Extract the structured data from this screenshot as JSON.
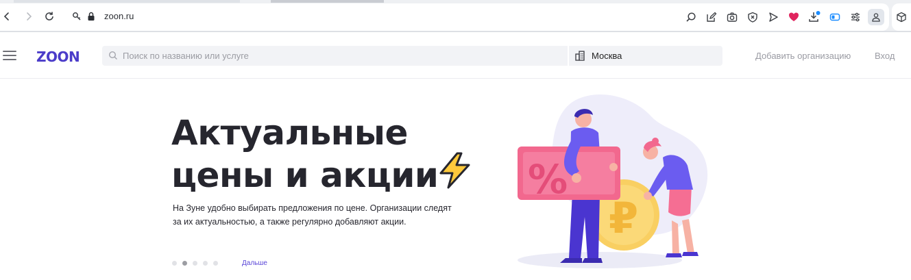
{
  "browser": {
    "url": "zoon.ru",
    "icons": [
      "back-icon",
      "forward-icon",
      "reload-icon",
      "site-info-icon",
      "lock-icon",
      "zoom-icon",
      "edit-icon",
      "camera-icon",
      "shield-icon",
      "send-icon",
      "heart-icon",
      "download-icon",
      "sidebar-toggle-icon",
      "settings-sliders-icon",
      "profile-icon",
      "box-icon"
    ]
  },
  "header": {
    "logo": "ZOON",
    "search_placeholder": "Поиск по названию или услуге",
    "city": "Москва",
    "add_org": "Добавить организацию",
    "login": "Вход"
  },
  "hero": {
    "title_line1": "Актуальные",
    "title_line2": "цены и акции",
    "description_line1": "На Зуне удобно выбирать предложения по цене. Организации следят",
    "description_line2": "за их актуальностью, а также регулярно добавляют акции.",
    "more": "Дальше",
    "slides_count": 5,
    "active_slide": 2
  },
  "colors": {
    "brand": "#4b3cc9",
    "link": "#5a46d8",
    "heart": "#e0245e",
    "badge": "#1a8cff"
  }
}
